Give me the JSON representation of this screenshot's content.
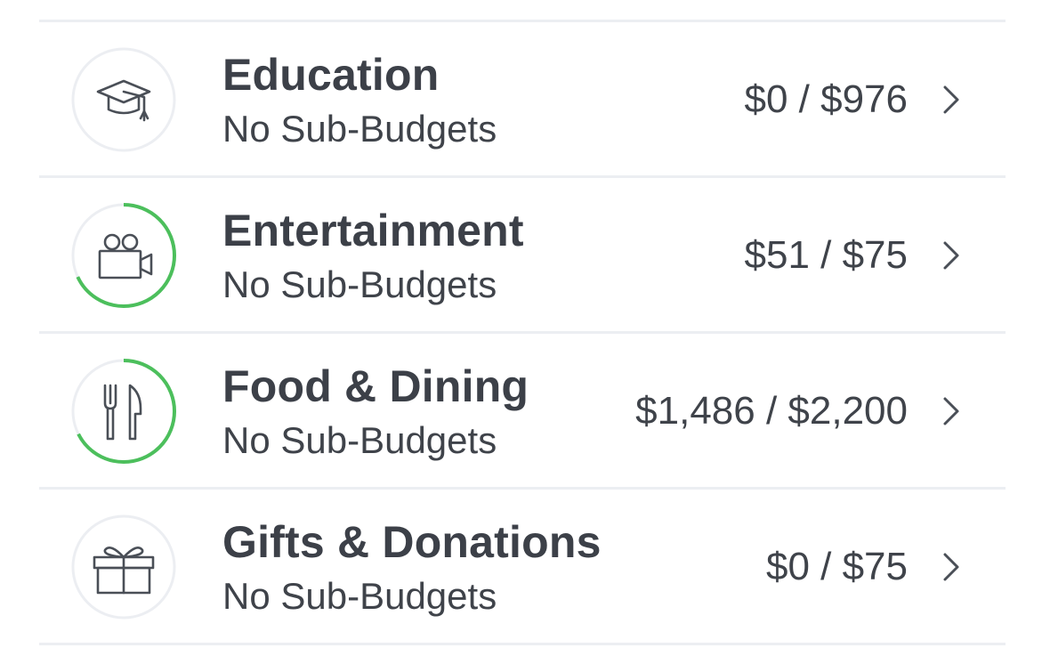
{
  "budgets": [
    {
      "title": "Education",
      "subtitle": "No Sub-Budgets",
      "amount": "$0 / $976",
      "icon": "graduation-cap-icon",
      "progress": 0
    },
    {
      "title": "Entertainment",
      "subtitle": "No Sub-Budgets",
      "amount": "$51 / $75",
      "icon": "film-camera-icon",
      "progress": 0.68
    },
    {
      "title": "Food & Dining",
      "subtitle": "No Sub-Budgets",
      "amount": "$1,486 / $2,200",
      "icon": "fork-knife-icon",
      "progress": 0.675
    },
    {
      "title": "Gifts & Donations",
      "subtitle": "No Sub-Budgets",
      "amount": "$0 / $75",
      "icon": "gift-icon",
      "progress": 0
    }
  ],
  "colors": {
    "progress": "#4cbf5c",
    "track": "#eceef2",
    "icon": "#4a4f57",
    "chevron": "#4a4f57"
  }
}
